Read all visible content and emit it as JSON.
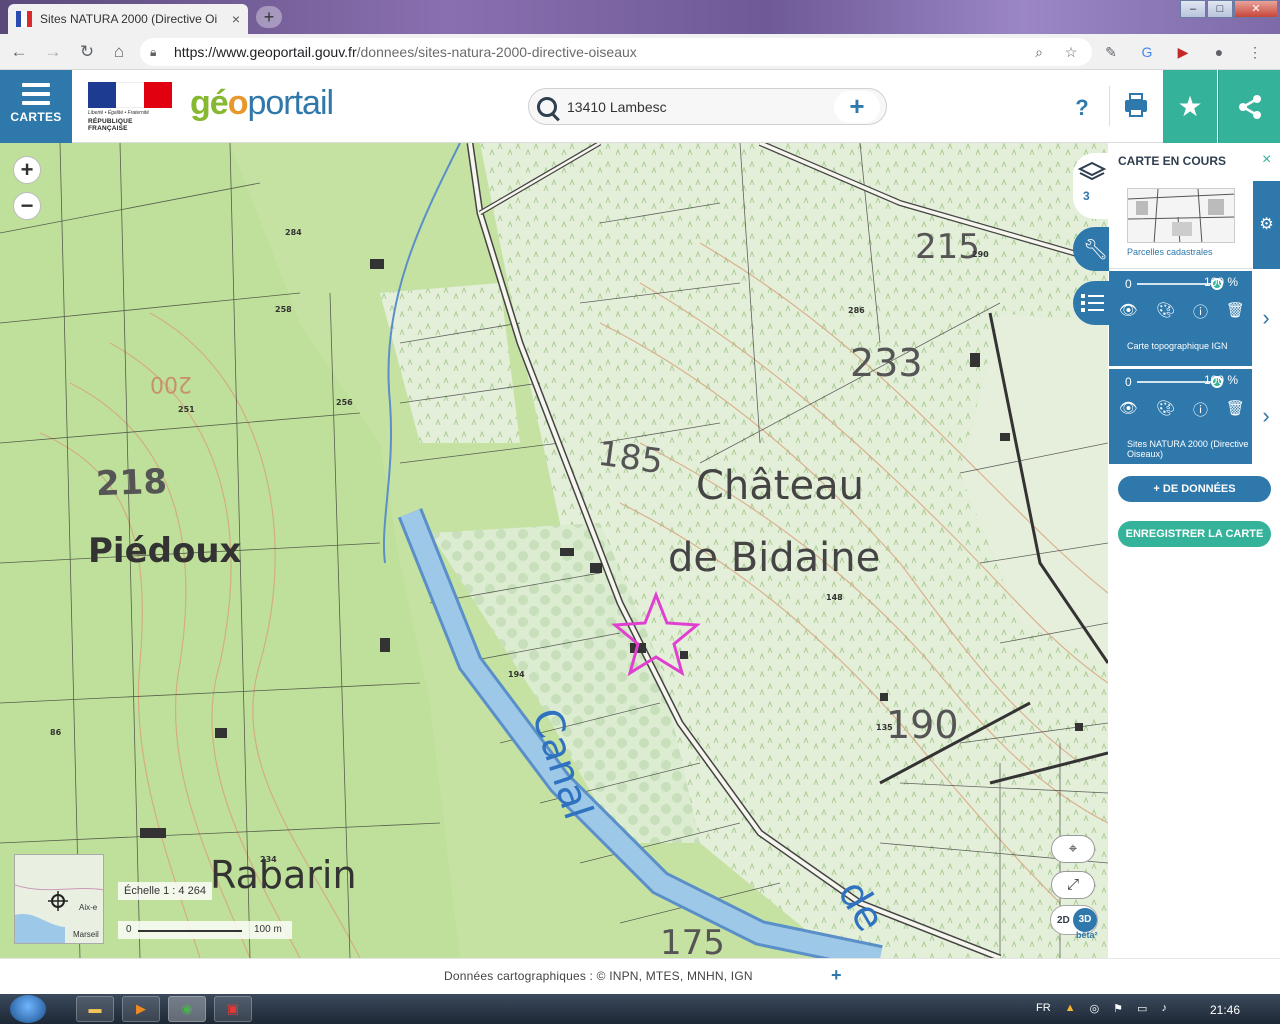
{
  "browser": {
    "tab_title": "Sites NATURA 2000 (Directive Oi",
    "tab_close": "×",
    "new_tab": "+",
    "url_host": "https://www.geoportail.gouv.fr",
    "url_path": "/donnees/sites-natura-2000-directive-oiseaux",
    "win_minimize": "–",
    "win_maximize": "□",
    "win_close": "✕"
  },
  "header": {
    "cartes_label": "CARTES",
    "republic_motto": "Liberté • Égalité • Fraternité",
    "republic_name": "RÉPUBLIQUE FRANÇAISE",
    "logo_part1": "gé",
    "logo_part2": "o",
    "logo_part3": "portail",
    "search_value": "13410 Lambesc",
    "search_add": "+",
    "help_label": "?",
    "favorite_icon": "★",
    "share_icon": "⋖"
  },
  "map": {
    "zoom_in": "+",
    "zoom_out": "−",
    "place_labels": {
      "piedoux": "Piédoux",
      "rabarin": "Rabarin",
      "chateau_line1": "Château",
      "chateau_line2": "de Bidaine",
      "canal": "Canal",
      "canal_de": "de"
    },
    "elevations": {
      "e218": "218",
      "e185": "185",
      "e215": "215",
      "e233": "233",
      "e190": "190",
      "e175": "175",
      "e200": "200"
    },
    "parcels": [
      "284",
      "258",
      "251",
      "256",
      "286",
      "290",
      "194",
      "148",
      "135",
      "234",
      "86"
    ],
    "minimap_labels": [
      "Aix-e",
      "Marseil"
    ],
    "scale_label": "Échelle 1 : 4 264",
    "scale_zero": "0",
    "scale_distance": "100 m",
    "view_2d": "2D",
    "view_3d": "3D",
    "beta_label": "bêta²"
  },
  "panel": {
    "title": "CARTE EN COURS",
    "close": "×",
    "layer_count": "3",
    "cadastre_name": "Parcelles cadastrales",
    "layers": [
      {
        "opacity_min": "0",
        "opacity_value": "100 %",
        "opacity_fraction": 1.0,
        "name": "Carte topographique IGN"
      },
      {
        "opacity_min": "0",
        "opacity_value": "100 %",
        "opacity_fraction": 1.0,
        "name": "Sites NATURA 2000 (Directive Oiseaux)"
      }
    ],
    "add_data_label": "+ DE DONNÉES",
    "save_map_label": "ENREGISTRER LA CARTE"
  },
  "footer": {
    "attribution": "Données cartographiques : ©  INPN,  MTES,  MNHN,  IGN",
    "more": "+"
  },
  "taskbar": {
    "lang": "FR",
    "clock": "21:46"
  },
  "colors": {
    "brand_blue": "#2f78ab",
    "brand_green": "#35b39a",
    "natura_star": "#e040d0",
    "canal": "#9ec8e8"
  }
}
